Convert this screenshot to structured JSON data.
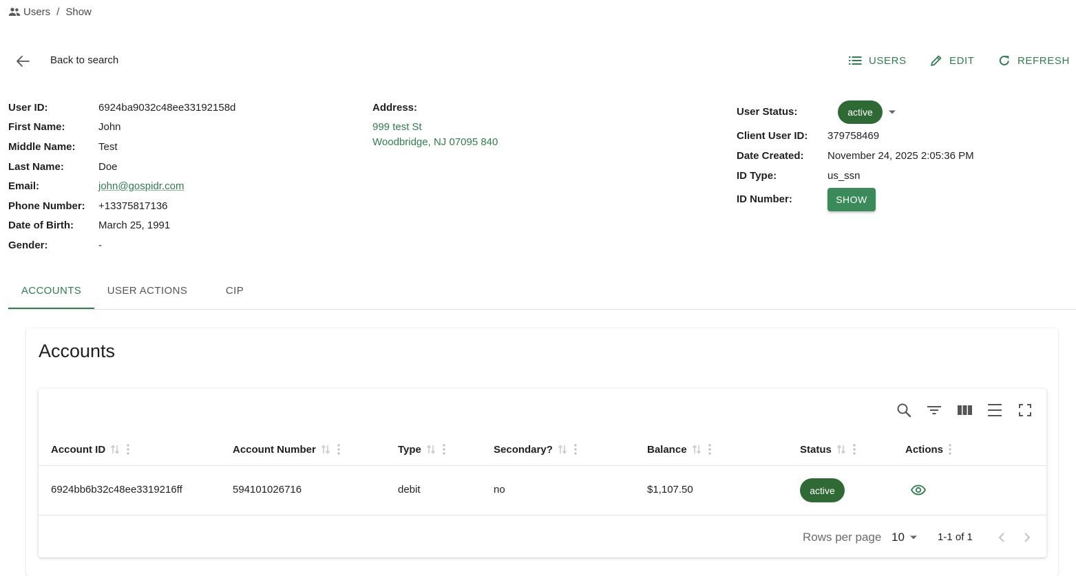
{
  "breadcrumb": {
    "section": "Users",
    "separator": "/",
    "current": "Show",
    "icon": "people-icon"
  },
  "header": {
    "back_label": "Back to search",
    "actions": {
      "users": "USERS",
      "edit": "EDIT",
      "refresh": "REFRESH"
    }
  },
  "user": {
    "labels": {
      "user_id": "User ID:",
      "first_name": "First Name:",
      "middle_name": "Middle Name:",
      "last_name": "Last Name:",
      "email": "Email:",
      "phone": "Phone Number:",
      "dob": "Date of Birth:",
      "gender": "Gender:"
    },
    "values": {
      "user_id": "6924ba9032c48ee33192158d",
      "first_name": "John",
      "middle_name": "Test",
      "last_name": "Doe",
      "email": "john@gospidr.com",
      "phone": "+13375817136",
      "dob": "March 25, 1991",
      "gender": "-"
    }
  },
  "address": {
    "label": "Address:",
    "line1": "999 test St",
    "line2": "Woodbridge, NJ 07095 840"
  },
  "meta": {
    "labels": {
      "status": "User Status:",
      "client_user_id": "Client User ID:",
      "date_created": "Date Created:",
      "id_type": "ID Type:",
      "id_number": "ID Number:"
    },
    "status": "active",
    "client_user_id": "379758469",
    "date_created": "November 24, 2025 2:05:36 PM",
    "id_type": "us_ssn",
    "show_label": "SHOW"
  },
  "tabs": [
    {
      "label": "ACCOUNTS"
    },
    {
      "label": "USER ACTIONS"
    },
    {
      "label": "CIP"
    }
  ],
  "accounts": {
    "title": "Accounts",
    "columns": [
      "Account ID",
      "Account Number",
      "Type",
      "Secondary?",
      "Balance",
      "Status",
      "Actions"
    ],
    "rows": [
      {
        "account_id": "6924bb6b32c48ee3319216ff",
        "account_number": "594101026716",
        "type": "debit",
        "secondary": "no",
        "balance": "$1,107.50",
        "status": "active"
      }
    ],
    "pagination": {
      "rows_per_page_label": "Rows per page",
      "rows_per_page": "10",
      "range": "1-1 of 1"
    }
  },
  "colors": {
    "accent": "#2e7d4f",
    "chip": "#2f6a35",
    "button": "#3a8a5a"
  }
}
